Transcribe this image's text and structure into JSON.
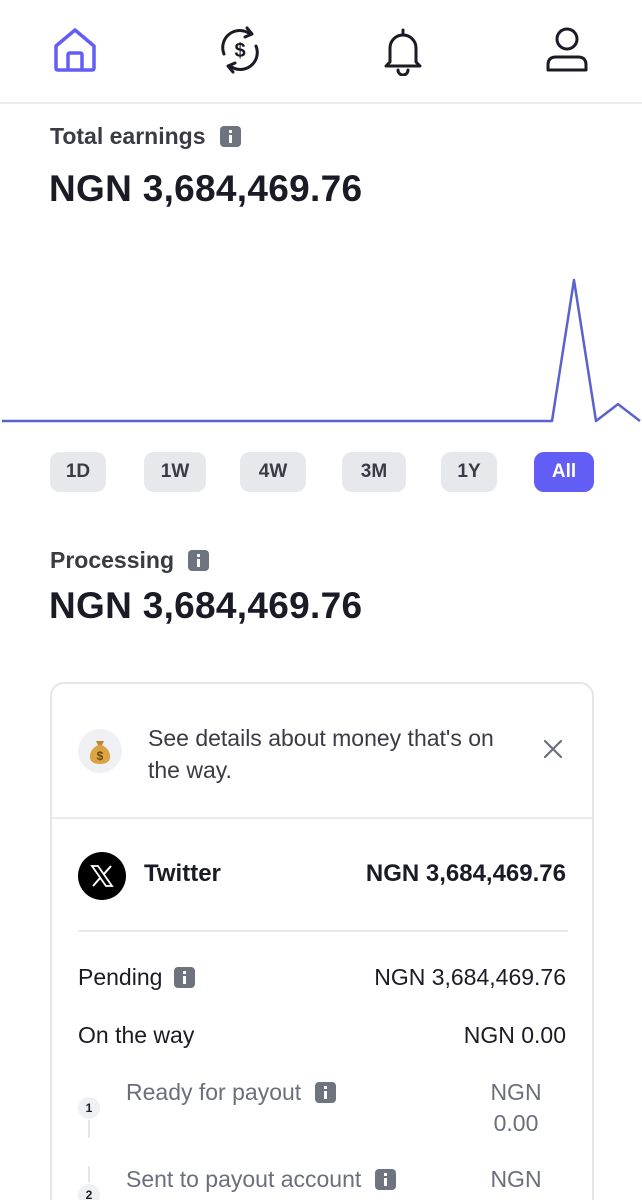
{
  "nav": {
    "items": [
      {
        "icon": "home-icon",
        "active": true
      },
      {
        "icon": "currency-exchange-icon",
        "active": false
      },
      {
        "icon": "bell-icon",
        "active": false
      },
      {
        "icon": "profile-icon",
        "active": false
      }
    ]
  },
  "earnings": {
    "label": "Total earnings",
    "amount": "NGN 3,684,469.76"
  },
  "chart_data": {
    "type": "line",
    "x": [
      0,
      1,
      2,
      3,
      4,
      5,
      6,
      7,
      8,
      9,
      10,
      11,
      12,
      13,
      14,
      15,
      16,
      17,
      18,
      19,
      20,
      21,
      22,
      23,
      24,
      25,
      26,
      27,
      28,
      29
    ],
    "series": [
      {
        "values": [
          0,
          0,
          0,
          0,
          0,
          0,
          0,
          0,
          0,
          0,
          0,
          0,
          0,
          0,
          0,
          0,
          0,
          0,
          0,
          0,
          0,
          0,
          0,
          0,
          0,
          0,
          1.0,
          0,
          0.12,
          0
        ]
      }
    ],
    "ylim": [
      0,
      1.0
    ],
    "color": "#5a62cf",
    "grid": false
  },
  "ranges": {
    "items": [
      "1D",
      "1W",
      "4W",
      "3M",
      "1Y",
      "All"
    ],
    "selected": "All"
  },
  "processing": {
    "label": "Processing",
    "amount": "NGN 3,684,469.76"
  },
  "card": {
    "banner_text": "See details about money that's on the way.",
    "platform": {
      "name": "Twitter",
      "amount": "NGN 3,684,469.76"
    },
    "pending": {
      "label": "Pending",
      "value": "NGN 3,684,469.76"
    },
    "on_the_way": {
      "label": "On the way",
      "value": "NGN 0.00"
    },
    "steps": [
      {
        "number": "1",
        "label": "Ready for payout",
        "value": "NGN 0.00"
      },
      {
        "number": "2",
        "label": "Sent to payout account",
        "value": "NGN"
      }
    ]
  },
  "colors": {
    "accent": "#625df5",
    "chart_line": "#5a62cf",
    "text_dark": "#1a1b25",
    "text_muted": "#6b6f7c"
  }
}
